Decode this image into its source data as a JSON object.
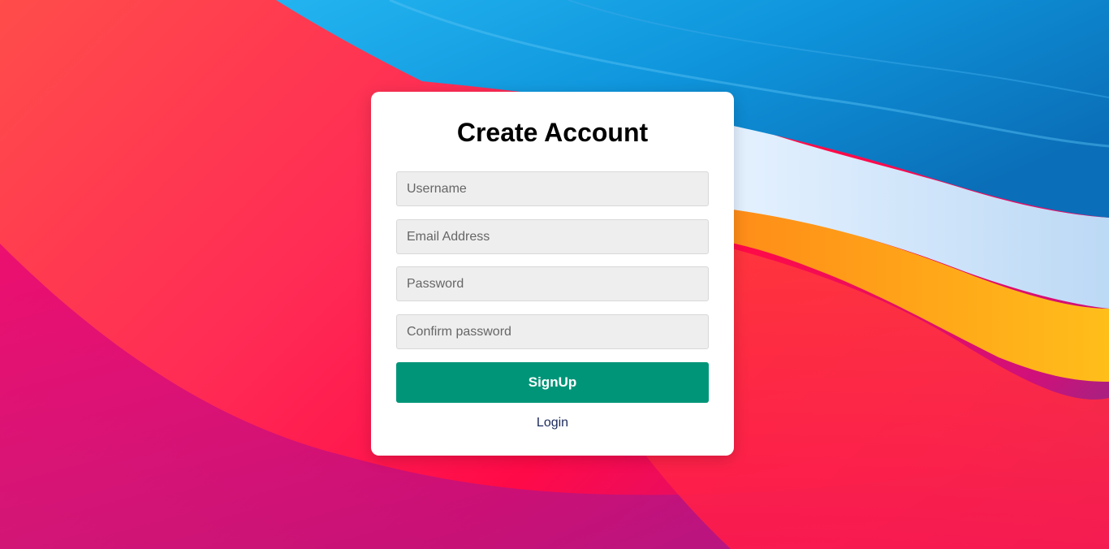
{
  "form": {
    "title": "Create Account",
    "username_placeholder": "Username",
    "email_placeholder": "Email Address",
    "password_placeholder": "Password",
    "confirm_placeholder": "Confirm password",
    "submit_label": "SignUp",
    "login_link": "Login"
  },
  "colors": {
    "button": "#009578",
    "card": "#ffffff",
    "field_bg": "#eeeeee"
  }
}
